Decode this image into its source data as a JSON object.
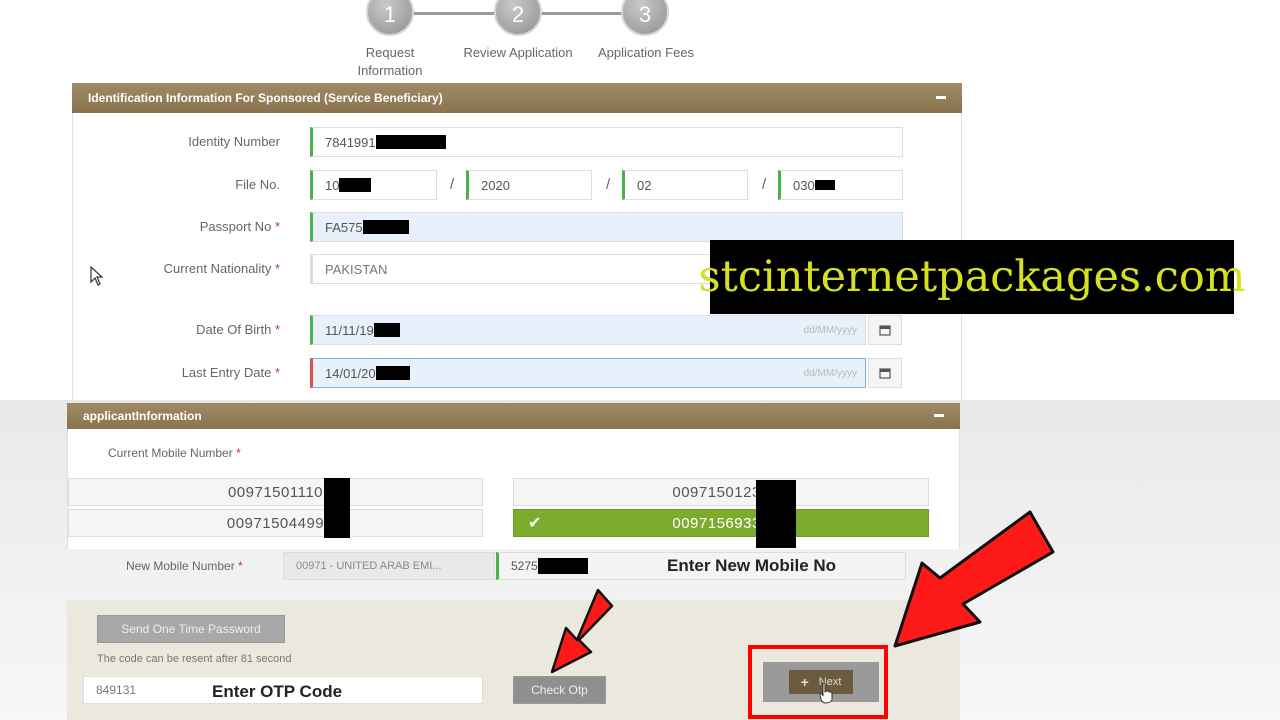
{
  "stepper": {
    "steps": [
      {
        "number": "1",
        "label_line1": "Request",
        "label_line2": "Information"
      },
      {
        "number": "2",
        "label_line1": "Review Application",
        "label_line2": ""
      },
      {
        "number": "3",
        "label_line1": "Application Fees",
        "label_line2": ""
      }
    ]
  },
  "identification": {
    "header": "Identification Information For Sponsored (Service Beneficiary)",
    "identity_label": "Identity Number",
    "identity_value": "7841991",
    "file_label": "File No.",
    "file_parts": [
      "10",
      "2020",
      "02",
      "030"
    ],
    "passport_label": "Passport No",
    "passport_value": "FA575",
    "nationality_label": "Current Nationality",
    "nationality_value": "PAKISTAN",
    "dob_label": "Date Of Birth",
    "dob_value": "11/11/19",
    "last_entry_label": "Last Entry Date",
    "last_entry_value": "14/01/20",
    "date_placeholder": "dd/MM/yyyy",
    "required_mark": "*"
  },
  "applicant": {
    "header": "applicantInformation",
    "current_mobile_label": "Current Mobile Number",
    "mobile_options": [
      "00971501110",
      "00971501230",
      "00971504499",
      "00971569330"
    ],
    "selected_index": 3,
    "new_mobile_label": "New Mobile Number",
    "country_code": "00971 - UNITED ARAB EMI...",
    "new_mobile_value": "5275",
    "send_otp_label": "Send One Time Password",
    "resend_note": "The code can be resent after 81 second",
    "otp_value": "849131",
    "check_otp_label": "Check Otp",
    "next_label": "Next"
  },
  "overlay": {
    "watermark": "stcinternetpackages.com",
    "enter_new_mobile": "Enter New Mobile No",
    "enter_otp": "Enter OTP Code"
  },
  "colors": {
    "panel_header": "#957f5b",
    "selected_green": "#7cac2e",
    "annotation_red": "#ff0000",
    "watermark_text": "#d4e021"
  }
}
